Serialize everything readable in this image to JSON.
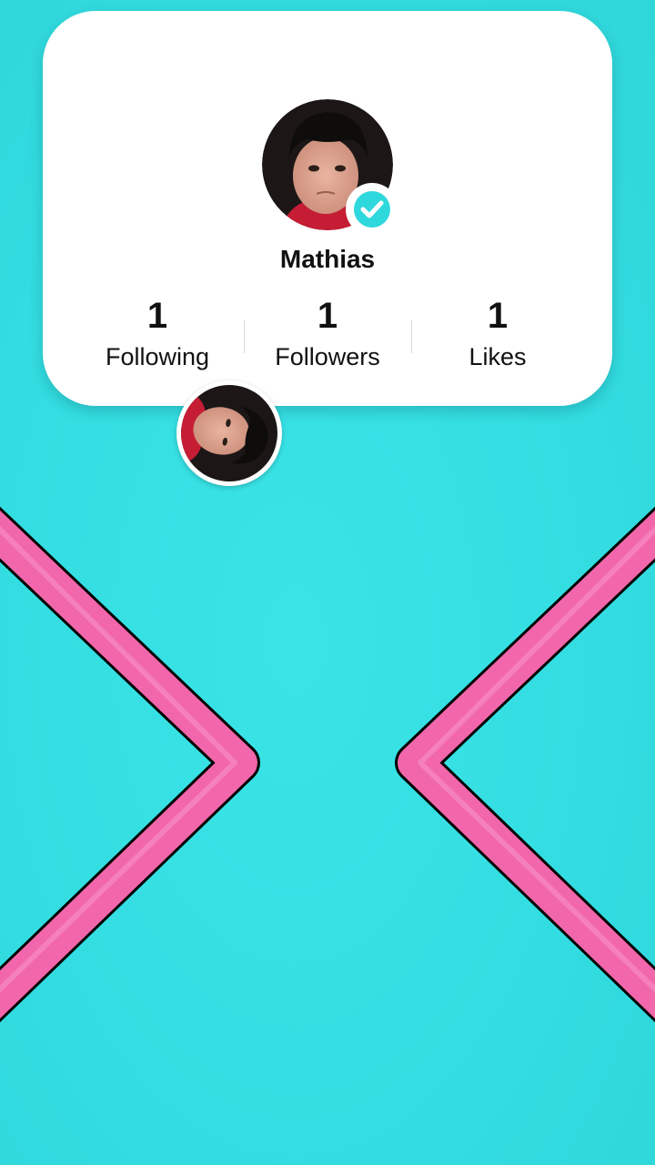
{
  "profile": {
    "name": "Mathias",
    "verified": true,
    "avatar": "profile-photo",
    "stats": [
      {
        "value": "1",
        "label": "Following"
      },
      {
        "value": "1",
        "label": "Followers"
      },
      {
        "value": "1",
        "label": "Likes"
      }
    ]
  },
  "colors": {
    "background": "#34dfe2",
    "chevron": "#f266ab",
    "card": "#ffffff",
    "verified_badge": "#2fd8dc"
  },
  "icons": {
    "verified": "check-badge-icon",
    "chevron_left": "chevron-left-icon",
    "chevron_right": "chevron-right-icon"
  }
}
